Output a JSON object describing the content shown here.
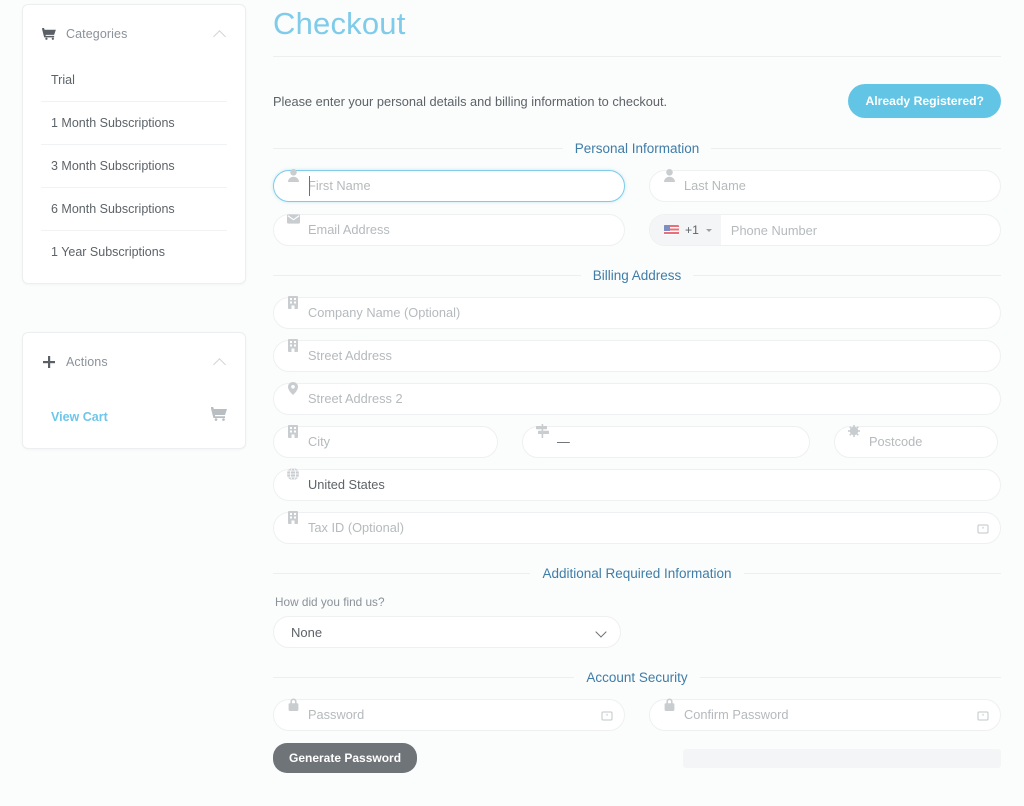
{
  "sidebar": {
    "categories_panel": {
      "title": "Categories",
      "icon": "cart-icon",
      "collapse_icon": "chevron-up-icon",
      "items": [
        {
          "label": "Trial"
        },
        {
          "label": "1 Month Subscriptions"
        },
        {
          "label": "3 Month Subscriptions"
        },
        {
          "label": "6 Month Subscriptions"
        },
        {
          "label": "1 Year Subscriptions"
        }
      ]
    },
    "actions_panel": {
      "title": "Actions",
      "icon": "plus-icon",
      "collapse_icon": "chevron-up-icon",
      "view_cart_label": "View Cart",
      "view_cart_icon": "cart-icon"
    }
  },
  "main": {
    "title": "Checkout",
    "intro_text": "Please enter your personal details and billing information to checkout.",
    "already_registered_label": "Already Registered?",
    "accent_color": "#63c5e5",
    "sections": {
      "personal": {
        "heading": "Personal Information",
        "first_name_placeholder": "First Name",
        "last_name_placeholder": "Last Name",
        "email_placeholder": "Email Address",
        "phone_placeholder": "Phone Number",
        "phone_country_code": "+1",
        "phone_flag": "us-flag-icon"
      },
      "billing": {
        "heading": "Billing Address",
        "company_placeholder": "Company Name (Optional)",
        "street1_placeholder": "Street Address",
        "street2_placeholder": "Street Address 2",
        "city_placeholder": "City",
        "state_value": "—",
        "postcode_placeholder": "Postcode",
        "country_value": "United States",
        "tax_id_placeholder": "Tax ID (Optional)"
      },
      "additional": {
        "heading": "Additional Required Information",
        "find_us_label": "How did you find us?",
        "find_us_value": "None"
      },
      "security": {
        "heading": "Account Security",
        "password_placeholder": "Password",
        "confirm_password_placeholder": "Confirm Password",
        "generate_password_label": "Generate Password"
      }
    }
  }
}
